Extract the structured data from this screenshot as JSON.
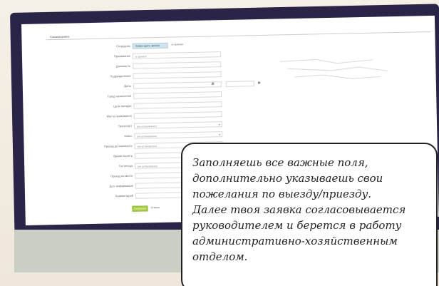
{
  "breadcrumb": "Командировка",
  "form": {
    "rows": [
      {
        "label": "Сотрудник",
        "type": "tabs",
        "tab_active": "Заявка (дата, время)",
        "tab_other": "в наличии"
      },
      {
        "label": "Проживание",
        "type": "input",
        "value": "в проекте"
      },
      {
        "label": "Должность",
        "type": "input",
        "value": ""
      },
      {
        "label": "Подразделение",
        "type": "input",
        "value": ""
      },
      {
        "label": "Даты",
        "type": "dates",
        "value": ""
      },
      {
        "label": "Город назначения",
        "type": "input",
        "value": ""
      },
      {
        "label": "Цель поездки",
        "type": "input",
        "value": ""
      },
      {
        "label": "Место проживания",
        "type": "input",
        "value": ""
      },
      {
        "label": "Транспорт",
        "type": "select",
        "value": "(не установлено)"
      },
      {
        "label": "Класс",
        "type": "select",
        "value": "(не установлено)"
      },
      {
        "label": "Проезд до аэропорта",
        "type": "select",
        "value": "(не установлено)"
      },
      {
        "label": "Время вылета",
        "type": "select",
        "value": ""
      },
      {
        "label": "Гостиница",
        "type": "select",
        "value": "(не установлено)"
      },
      {
        "label": "Проезд на месте",
        "type": "input",
        "value": ""
      },
      {
        "label": "Доп. информация",
        "type": "input",
        "value": ""
      },
      {
        "label": "Комментарий",
        "type": "input",
        "value": ""
      }
    ],
    "submit_label": "Сохранить",
    "cancel_label": "Отмена"
  },
  "callout": {
    "lines": [
      "Заполняешь все важные поля,",
      "дополнительно указываешь свои",
      "пожелания по выезду/приезду.",
      "Далее твоя заявка согласовывается",
      "руководителем и берется в работу",
      "административно-хозяйственным",
      "отделом."
    ]
  },
  "colors": {
    "monitor": "#2a2546",
    "submit": "#a8cf45",
    "tab_active": "#cfe4ec"
  }
}
